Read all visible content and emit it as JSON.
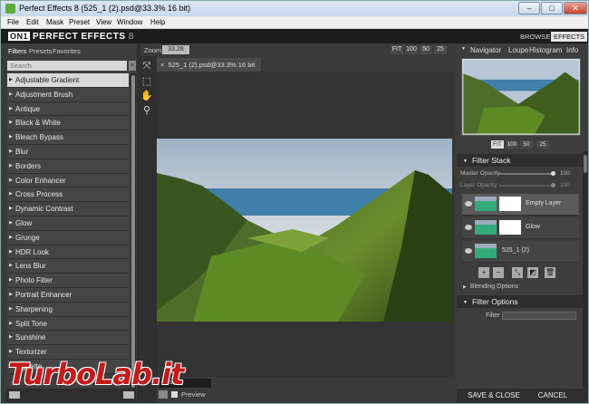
{
  "window": {
    "title": "Perfect Effects 8 (525_1 (2).psd@33.3% 16 bit)"
  },
  "menu": [
    "File",
    "Edit",
    "Mask",
    "Preset",
    "View",
    "Window",
    "Help"
  ],
  "app": {
    "logo_badge": "ON1",
    "logo_name": "PERFECT EFFECTS",
    "logo_version": "8",
    "modes": [
      "BROWSE",
      "EFFECTS"
    ],
    "active_mode": "EFFECTS"
  },
  "left_panel": {
    "tabs": [
      "Filters",
      "Presets",
      "Favorites"
    ],
    "search_placeholder": "Search",
    "filters": [
      "Adjustable Gradient",
      "Adjustment Brush",
      "Antique",
      "Black & White",
      "Bleach Bypass",
      "Blur",
      "Borders",
      "Color Enhancer",
      "Cross Process",
      "Dynamic Contrast",
      "Glow",
      "Grunge",
      "HDR Look",
      "Lens Blur",
      "Photo Filter",
      "Portrait Enhancer",
      "Sharpening",
      "Split Tone",
      "Sunshine",
      "Texturizer",
      "Vignette"
    ],
    "selected_filter": "Adjustable Gradient"
  },
  "tools": [
    "transform-icon",
    "crop-icon",
    "hand-icon",
    "zoom-icon"
  ],
  "zoom": {
    "label": "Zoom",
    "value": "33.28",
    "presets": [
      "FIT",
      "100",
      "50",
      "25"
    ]
  },
  "document": {
    "tab_label": "525_1 (2).psd@33.3% 16 bit",
    "close_glyph": "×"
  },
  "canvas_footer": {
    "reset_label": "Reset",
    "preview_label": "Preview",
    "preview_checked": true
  },
  "right_panel": {
    "nav_tabs": [
      "Navigator",
      "Loupe",
      "Histogram",
      "Info"
    ],
    "nav_zoom": [
      "FIT",
      "100",
      "50",
      "25"
    ],
    "filter_stack": {
      "title": "Filter Stack",
      "master_opacity_label": "Master Opacity",
      "master_opacity": "100",
      "layer_opacity_label": "Layer Opacity",
      "layer_opacity": "100",
      "layers": [
        {
          "name": "Empty Layer",
          "selected": true
        },
        {
          "name": "Glow",
          "selected": false
        },
        {
          "name": "525_1 (2)",
          "selected": false
        }
      ],
      "blending_label": "Blending Options"
    },
    "filter_options": {
      "title": "Filter Options",
      "filter_label": "Filter"
    },
    "save_label": "SAVE & CLOSE",
    "cancel_label": "CANCEL"
  },
  "watermark": "TurboLab.it"
}
